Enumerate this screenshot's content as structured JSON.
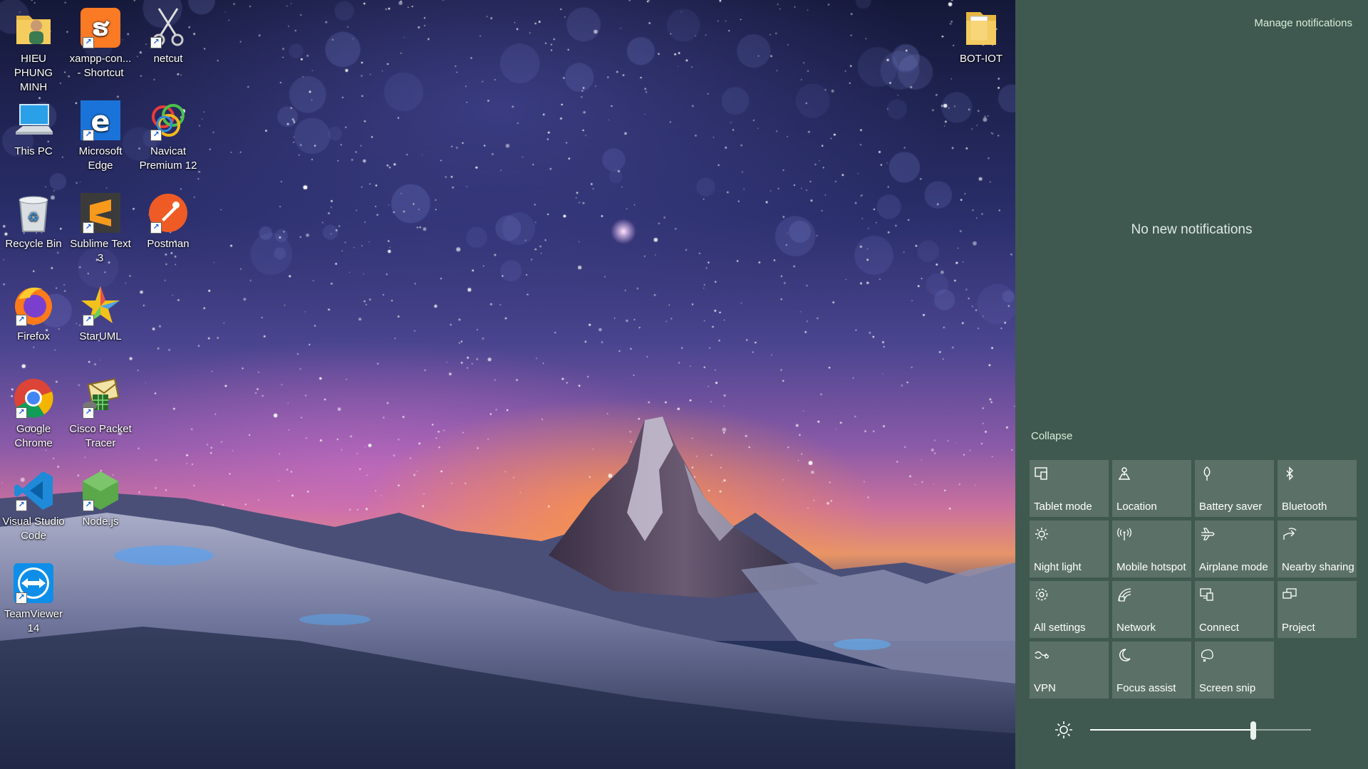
{
  "desktop": {
    "icons": [
      {
        "label": "HIEU PHUNG MINH",
        "icon": "user-folder-icon"
      },
      {
        "label": "xampp-con... - Shortcut",
        "icon": "xampp-icon"
      },
      {
        "label": "netcut",
        "icon": "scissors-icon"
      },
      {
        "label": "This PC",
        "icon": "computer-icon"
      },
      {
        "label": "Microsoft Edge",
        "icon": "edge-icon"
      },
      {
        "label": "Navicat Premium 12",
        "icon": "navicat-icon"
      },
      {
        "label": "Recycle Bin",
        "icon": "recycle-bin-icon"
      },
      {
        "label": "Sublime Text 3",
        "icon": "sublime-icon"
      },
      {
        "label": "Postman",
        "icon": "postman-icon"
      },
      {
        "label": "Firefox",
        "icon": "firefox-icon"
      },
      {
        "label": "StarUML",
        "icon": "staruml-icon"
      },
      {
        "label": "Google Chrome",
        "icon": "chrome-icon"
      },
      {
        "label": "Cisco Packet Tracer",
        "icon": "packet-tracer-icon"
      },
      {
        "label": "Visual Studio Code",
        "icon": "vscode-icon"
      },
      {
        "label": "Node.js",
        "icon": "nodejs-icon"
      },
      {
        "label": "TeamViewer 14",
        "icon": "teamviewer-icon"
      },
      {
        "label": "BOT-IOT",
        "icon": "folder-icon"
      }
    ]
  },
  "action_center": {
    "manage_notifications": "Manage notifications",
    "no_notifications": "No new notifications",
    "collapse": "Collapse",
    "tiles": [
      {
        "label": "Tablet mode",
        "icon": "tablet-mode-icon"
      },
      {
        "label": "Location",
        "icon": "location-icon"
      },
      {
        "label": "Battery saver",
        "icon": "battery-saver-icon"
      },
      {
        "label": "Bluetooth",
        "icon": "bluetooth-icon"
      },
      {
        "label": "Night light",
        "icon": "night-light-icon"
      },
      {
        "label": "Mobile hotspot",
        "icon": "mobile-hotspot-icon"
      },
      {
        "label": "Airplane mode",
        "icon": "airplane-icon"
      },
      {
        "label": "Nearby sharing",
        "icon": "nearby-sharing-icon"
      },
      {
        "label": "All settings",
        "icon": "gear-icon"
      },
      {
        "label": "Network",
        "icon": "network-icon"
      },
      {
        "label": "Connect",
        "icon": "connect-icon"
      },
      {
        "label": "Project",
        "icon": "project-icon"
      },
      {
        "label": "VPN",
        "icon": "vpn-icon"
      },
      {
        "label": "Focus assist",
        "icon": "moon-icon"
      },
      {
        "label": "Screen snip",
        "icon": "screen-snip-icon"
      }
    ],
    "brightness": {
      "level": 0.74,
      "icon": "brightness-icon"
    }
  },
  "colors": {
    "action_center_bg": "#3f5950",
    "tile_bg": "#5b7168",
    "link_text": "#d8ecd9"
  }
}
